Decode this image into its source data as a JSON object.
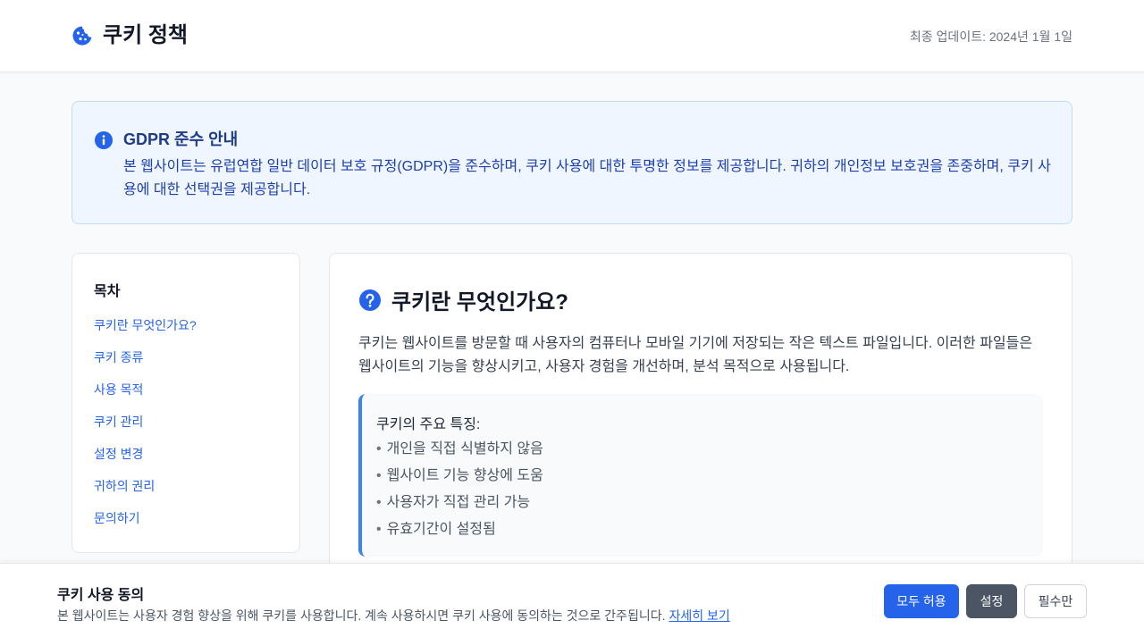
{
  "header": {
    "title": "쿠키 정책",
    "updated": "최종 업데이트: 2024년 1월 1일",
    "logo_icon": "cookie-icon"
  },
  "notice": {
    "icon": "info-icon",
    "title": "GDPR 준수 안내",
    "body": "본 웹사이트는 유럽연합 일반 데이터 보호 규정(GDPR)을 준수하며, 쿠키 사용에 대한 투명한 정보를 제공합니다. 귀하의 개인정보 보호권을 존중하며, 쿠키 사용에 대한 선택권을 제공합니다."
  },
  "toc": {
    "title": "목차",
    "items": [
      {
        "label": "쿠키란 무엇인가요?"
      },
      {
        "label": "쿠키 종류"
      },
      {
        "label": "사용 목적"
      },
      {
        "label": "쿠키 관리"
      },
      {
        "label": "설정 변경"
      },
      {
        "label": "귀하의 권리"
      },
      {
        "label": "문의하기"
      }
    ]
  },
  "section": {
    "icon": "question-circle-icon",
    "title": "쿠키란 무엇인가요?",
    "paragraph": "쿠키는 웹사이트를 방문할 때 사용자의 컴퓨터나 모바일 기기에 저장되는 작은 텍스트 파일입니다. 이러한 파일들은 웹사이트의 기능을 향상시키고, 사용자 경험을 개선하며, 분석 목적으로 사용됩니다.",
    "features_title": "쿠키의 주요 특징:",
    "features": [
      "개인을 직접 식별하지 않음",
      "웹사이트 기능 향상에 도움",
      "사용자가 직접 관리 가능",
      "유효기간이 설정됨"
    ],
    "bullet": "•"
  },
  "banner": {
    "title": "쿠키 사용 동의",
    "text": "본 웹사이트는 사용자 경험 향상을 위해 쿠키를 사용합니다. 계속 사용하시면 쿠키 사용에 동의하는 것으로 간주됩니다.",
    "link": "자세히 보기",
    "accept_label": "모두 허용",
    "settings_label": "설정",
    "essential_label": "필수만"
  },
  "colors": {
    "accent": "#2563eb",
    "notice_bg": "#eff6ff",
    "settings_btn": "#4b5563"
  }
}
